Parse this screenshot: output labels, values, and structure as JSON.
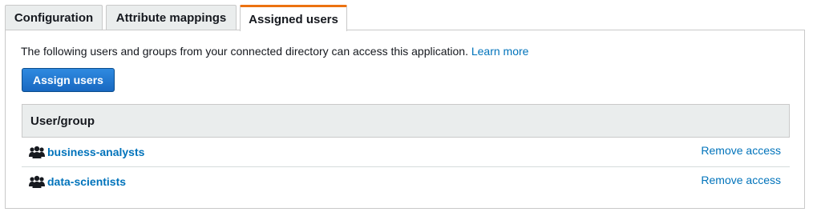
{
  "tabs": [
    {
      "label": "Configuration"
    },
    {
      "label": "Attribute mappings"
    },
    {
      "label": "Assigned users",
      "active": true
    }
  ],
  "panel": {
    "description": "The following users and groups from your connected directory can access this application.",
    "learn_more": "Learn more",
    "assign_button": "Assign users"
  },
  "table": {
    "header": "User/group",
    "rows": [
      {
        "name": "business-analysts",
        "icon": "group-icon",
        "action": "Remove access"
      },
      {
        "name": "data-scientists",
        "icon": "group-icon",
        "action": "Remove access"
      }
    ]
  },
  "colors": {
    "accent_tab": "#ec7211",
    "link": "#0073bb",
    "button": "#1868c1"
  }
}
